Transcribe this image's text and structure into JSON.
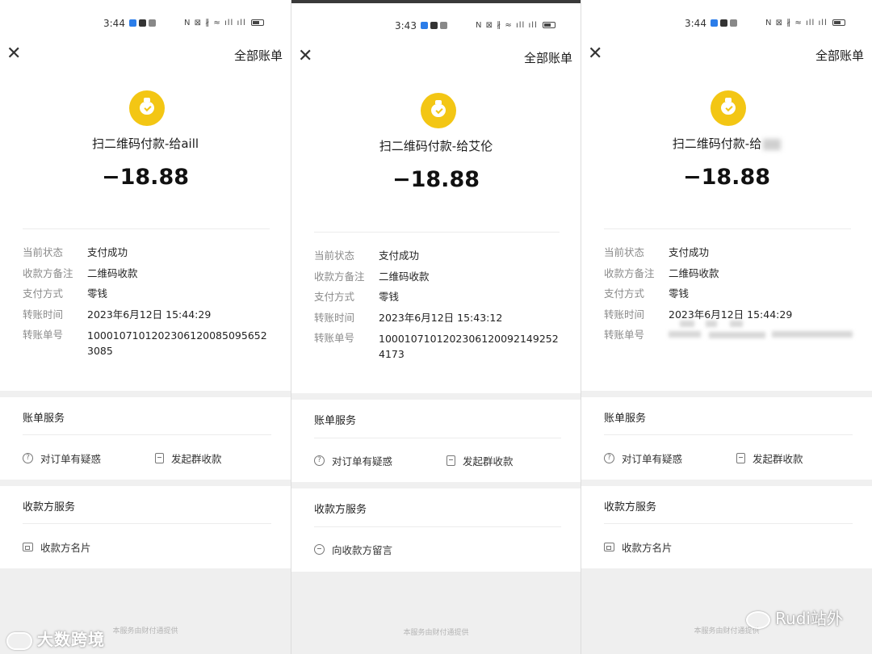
{
  "panels": [
    {
      "status_time": "3:44",
      "close_glyph": "✕",
      "all_bills": "全部账单",
      "title": "扫二维码付款-给aill",
      "amount": "−18.88",
      "rows": [
        {
          "label": "当前状态",
          "value": "支付成功"
        },
        {
          "label": "收款方备注",
          "value": "二维码收款"
        },
        {
          "label": "支付方式",
          "value": "零钱"
        },
        {
          "label": "转账时间",
          "value": "2023年6月12日 15:44:29"
        },
        {
          "label": "转账单号",
          "value": "10001071012023061200850956523085"
        }
      ],
      "bill_service": "账单服务",
      "question": "对订单有疑惑",
      "group": "发起群收款",
      "payee_service": "收款方服务",
      "payee_action": "收款方名片",
      "footer": "本服务由财付通提供"
    },
    {
      "status_time": "3:43",
      "close_glyph": "✕",
      "all_bills": "全部账单",
      "title": "扫二维码付款-给艾伦",
      "amount": "−18.88",
      "rows": [
        {
          "label": "当前状态",
          "value": "支付成功"
        },
        {
          "label": "收款方备注",
          "value": "二维码收款"
        },
        {
          "label": "支付方式",
          "value": "零钱"
        },
        {
          "label": "转账时间",
          "value": "2023年6月12日 15:43:12"
        },
        {
          "label": "转账单号",
          "value": "10001071012023061200921492524173"
        }
      ],
      "bill_service": "账单服务",
      "question": "对订单有疑惑",
      "group": "发起群收款",
      "payee_service": "收款方服务",
      "payee_action": "向收款方留言",
      "footer": "本服务由财付通提供"
    },
    {
      "status_time": "3:44",
      "close_glyph": "✕",
      "all_bills": "全部账单",
      "title": "扫二维码付款-给",
      "amount": "−18.88",
      "rows": [
        {
          "label": "当前状态",
          "value": "支付成功"
        },
        {
          "label": "收款方备注",
          "value": "二维码收款"
        },
        {
          "label": "支付方式",
          "value": "零钱"
        },
        {
          "label": "转账时间",
          "value": "2023年6月12日 15:44:29"
        },
        {
          "label": "转账单号",
          "value": ""
        }
      ],
      "bill_service": "账单服务",
      "question": "对订单有疑惑",
      "group": "发起群收款",
      "payee_service": "收款方服务",
      "payee_action": "收款方名片",
      "footer": "本服务由财付通提供"
    }
  ],
  "watermarks": {
    "left": "大数跨境",
    "right": "Rudi站外"
  },
  "colors": {
    "coin": "#f3c614",
    "background": "#ffffff",
    "divider": "#f0f0f0"
  }
}
